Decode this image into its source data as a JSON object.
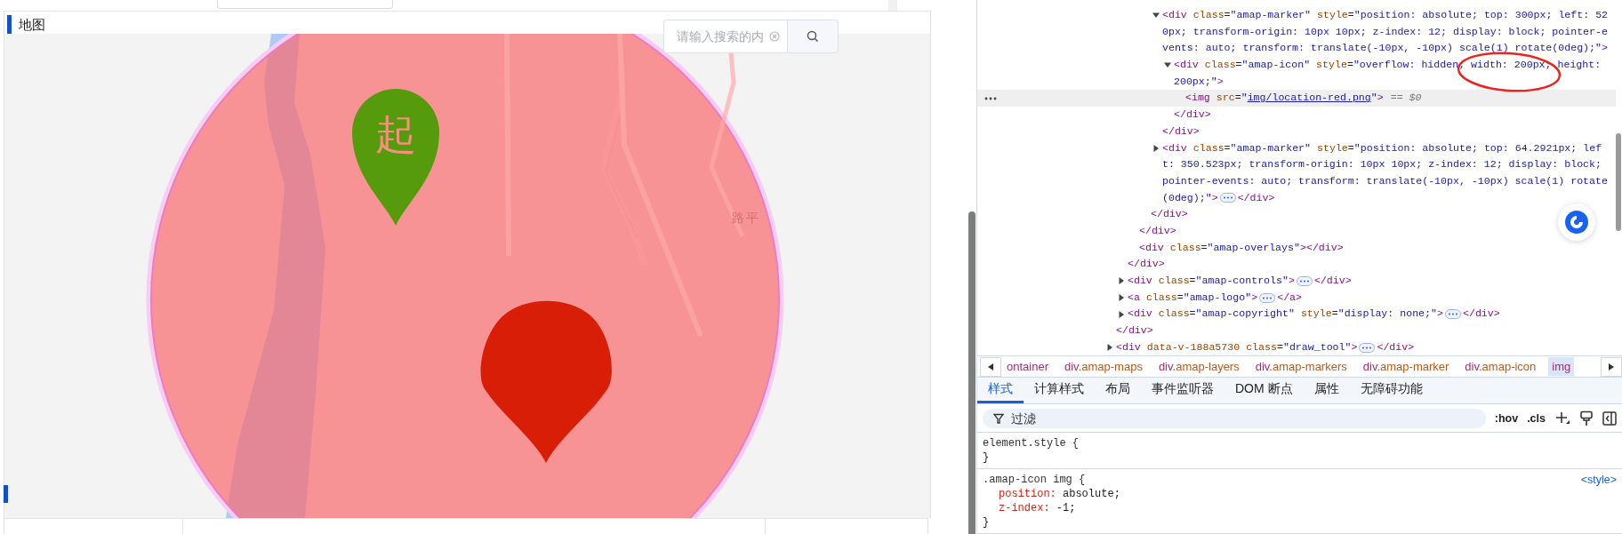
{
  "page": {
    "panel_title": "地图",
    "search": {
      "placeholder": "请输入搜索的内"
    },
    "map": {
      "start_marker_label": "起",
      "place_label": "路平"
    }
  },
  "devtools": {
    "elements_tree": [
      {
        "children": [
          {
            "close": "</div>",
            "children": [
              {
                "close": "</div>",
                "children": [
                  {
                    "close": "</div>",
                    "children": [
                      {
                        "close": "</div>",
                        "children": [
                          {
                            "lines": [
                              "<div class=\"amap-marker\" style=\"position: absolute; top: 300px; left: 52",
                              "0px; transform-origin: 10px 10px; z-index: 12; display: block; pointer-e",
                              "vents: auto; transform: translate(-10px, -10px) scale(1) rotate(0deg);\">"
                            ],
                            "expanded": true,
                            "selected": false,
                            "close": "</div>",
                            "children": [
                              {
                                "lines": [
                                  "<div class=\"amap-icon\" style=\"overflow: hidden; width: 200px; height:",
                                  "200px;\">"
                                ],
                                "expanded": true,
                                "selected": false,
                                "close": "</div>",
                                "children": [
                                  {
                                    "lines": [
                                      "<img src=\"img/location-red.png\">"
                                    ],
                                    "linked": true,
                                    "selected": true,
                                    "console_ref": "== $0"
                                  }
                                ]
                              }
                            ]
                          },
                          {
                            "lines": [
                              "<div class=\"amap-marker\" style=\"position: absolute; top: 64.2921px; lef",
                              "t: 350.523px; transform-origin: 10px 10px; z-index: 12; display: block;",
                              "pointer-events: auto; transform: translate(-10px, -10px) scale(1) rotate",
                              "(0deg);\">"
                            ],
                            "expanded": false,
                            "selected": false,
                            "close": "</div>"
                          }
                        ]
                      }
                    ]
                  },
                  {
                    "lines": [
                      "<div class=\"amap-overlays\">"
                    ],
                    "selected": false,
                    "close": "</div>"
                  }
                ]
              },
              {
                "lines": [
                  "<div class=\"amap-controls\">"
                ],
                "expanded": false,
                "selected": false,
                "close": "</div>"
              },
              {
                "lines": [
                  "<a class=\"amap-logo\">"
                ],
                "expanded": false,
                "selected": false,
                "close": "</a>"
              },
              {
                "lines": [
                  "<div class=\"amap-copyright\" style=\"display: none;\">"
                ],
                "expanded": false,
                "selected": false,
                "close": "</div>"
              }
            ]
          },
          {
            "lines": [
              "<div data-v-188a5730 class=\"draw_tool\">"
            ],
            "expanded": false,
            "selected": false,
            "close": "</div>"
          }
        ]
      }
    ],
    "breadcrumbs": [
      {
        "label": "ontainer",
        "selected": false
      },
      {
        "label": "div.amap-maps",
        "selected": false
      },
      {
        "label": "div.amap-layers",
        "selected": false
      },
      {
        "label": "div.amap-markers",
        "selected": false
      },
      {
        "label": "div.amap-marker",
        "selected": false
      },
      {
        "label": "div.amap-icon",
        "selected": false
      },
      {
        "label": "img",
        "selected": true
      }
    ],
    "tabs": [
      {
        "label": "样式",
        "selected": true
      },
      {
        "label": "计算样式",
        "selected": false
      },
      {
        "label": "布局",
        "selected": false
      },
      {
        "label": "事件监听器",
        "selected": false
      },
      {
        "label": "DOM 断点",
        "selected": false
      },
      {
        "label": "属性",
        "selected": false
      },
      {
        "label": "无障碍功能",
        "selected": false
      }
    ],
    "filter": {
      "placeholder": "过滤"
    },
    "toolbar": [
      ":hov",
      ".cls"
    ],
    "rules": [
      {
        "selector": "element.style {",
        "close": "}"
      },
      {
        "selector": ".amap-icon img {",
        "source": "<style>",
        "declarations": [
          {
            "property": "position:",
            "value": "absolute;"
          },
          {
            "property": "z-index:",
            "value": "-1;"
          }
        ],
        "close": "}"
      }
    ]
  }
}
